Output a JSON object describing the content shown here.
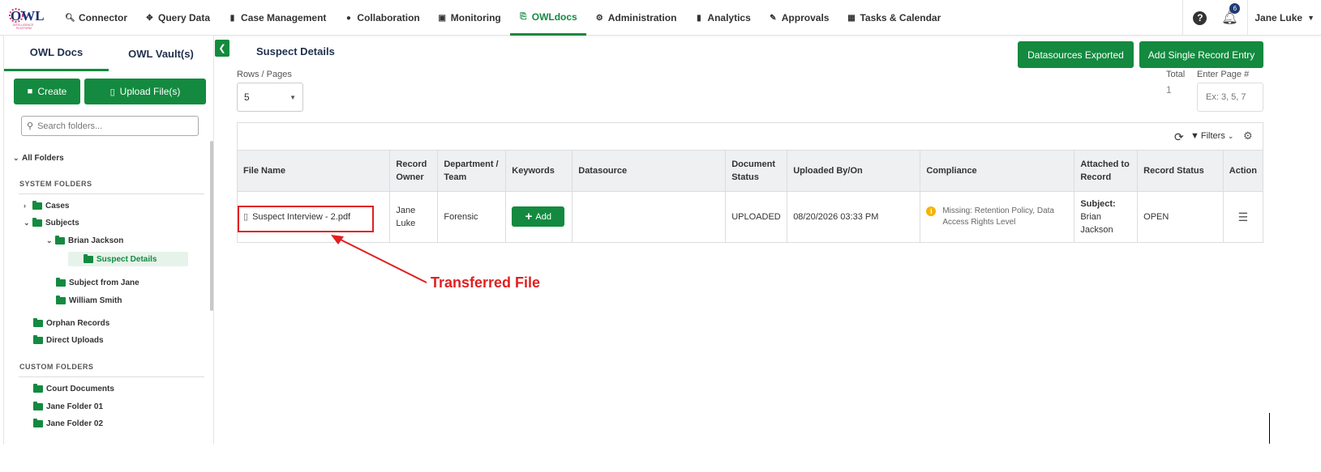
{
  "app": {
    "logo_text": "OWL",
    "logo_subtext": "INTELLIGENCE PLATFORM"
  },
  "nav": {
    "items": [
      {
        "label": "Connector",
        "icon": "search-icon"
      },
      {
        "label": "Query Data",
        "icon": "move-icon"
      },
      {
        "label": "Case Management",
        "icon": "id-card-icon"
      },
      {
        "label": "Collaboration",
        "icon": "users-icon"
      },
      {
        "label": "Monitoring",
        "icon": "monitor-icon"
      },
      {
        "label": "OWLdocs",
        "icon": "file-export-icon",
        "active": true
      },
      {
        "label": "Administration",
        "icon": "users-cog-icon"
      },
      {
        "label": "Analytics",
        "icon": "file-chart-icon"
      },
      {
        "label": "Approvals",
        "icon": "stamp-icon"
      },
      {
        "label": "Tasks & Calendar",
        "icon": "calendar-icon"
      }
    ],
    "notification_count": "6",
    "user_name": "Jane Luke"
  },
  "sidebar": {
    "tabs": [
      "OWL Docs",
      "OWL Vault(s)"
    ],
    "create_label": "Create",
    "upload_label": "Upload File(s)",
    "search_placeholder": "Search folders...",
    "all_folders": "All Folders",
    "system_folders_label": "SYSTEM FOLDERS",
    "custom_folders_label": "CUSTOM FOLDERS",
    "tree": {
      "cases": "Cases",
      "subjects": "Subjects",
      "brian_jackson": "Brian Jackson",
      "suspect_details": "Suspect Details",
      "subject_from_jane": "Subject from Jane",
      "william_smith": "William Smith",
      "orphan_records": "Orphan Records",
      "direct_uploads": "Direct Uploads",
      "court_documents": "Court Documents",
      "jane_folder_01": "Jane Folder 01",
      "jane_folder_02": "Jane Folder 02"
    }
  },
  "main": {
    "title": "Suspect Details",
    "datasources_exported_label": "Datasources Exported",
    "add_single_record_label": "Add Single Record Entry",
    "rows_pages_label": "Rows / Pages",
    "rows_value": "5",
    "total_label": "Total",
    "total_value": "1",
    "enter_page_label": "Enter Page #",
    "enter_page_placeholder": "Ex: 3, 5, 7",
    "filters_label": "Filters",
    "columns": {
      "file_name": "File Name",
      "record_owner": "Record Owner",
      "department_team": "Department / Team",
      "keywords": "Keywords",
      "datasource": "Datasource",
      "document_status": "Document Status",
      "uploaded_by_on": "Uploaded By/On",
      "compliance": "Compliance",
      "attached_to_record": "Attached to Record",
      "record_status": "Record Status",
      "action": "Action"
    },
    "rows": [
      {
        "file_name": "Suspect Interview - 2.pdf",
        "record_owner": "Jane Luke",
        "department_team": "Forensic",
        "keywords_add_label": "Add",
        "datasource": "",
        "document_status": "UPLOADED",
        "uploaded_by_on": "08/20/2026 03:33 PM",
        "compliance": "Missing: Retention Policy, Data Access Rights Level",
        "attached_prefix": "Subject:",
        "attached_name": "Brian Jackson",
        "record_status": "OPEN"
      }
    ]
  },
  "annotation": {
    "label": "Transferred File",
    "color": "#e02020"
  },
  "colors": {
    "accent": "#138a3f",
    "title_navy": "#1f2f4d"
  }
}
